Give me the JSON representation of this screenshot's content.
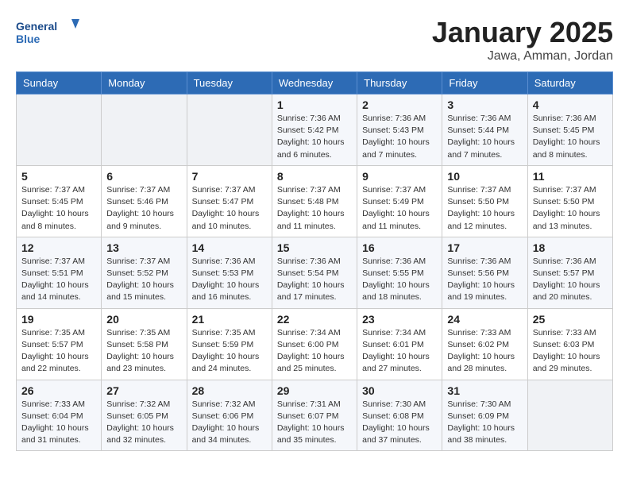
{
  "header": {
    "logo_general": "General",
    "logo_blue": "Blue",
    "month_title": "January 2025",
    "location": "Jawa, Amman, Jordan"
  },
  "weekdays": [
    "Sunday",
    "Monday",
    "Tuesday",
    "Wednesday",
    "Thursday",
    "Friday",
    "Saturday"
  ],
  "weeks": [
    [
      {
        "day": "",
        "info": ""
      },
      {
        "day": "",
        "info": ""
      },
      {
        "day": "",
        "info": ""
      },
      {
        "day": "1",
        "info": "Sunrise: 7:36 AM\nSunset: 5:42 PM\nDaylight: 10 hours\nand 6 minutes."
      },
      {
        "day": "2",
        "info": "Sunrise: 7:36 AM\nSunset: 5:43 PM\nDaylight: 10 hours\nand 7 minutes."
      },
      {
        "day": "3",
        "info": "Sunrise: 7:36 AM\nSunset: 5:44 PM\nDaylight: 10 hours\nand 7 minutes."
      },
      {
        "day": "4",
        "info": "Sunrise: 7:36 AM\nSunset: 5:45 PM\nDaylight: 10 hours\nand 8 minutes."
      }
    ],
    [
      {
        "day": "5",
        "info": "Sunrise: 7:37 AM\nSunset: 5:45 PM\nDaylight: 10 hours\nand 8 minutes."
      },
      {
        "day": "6",
        "info": "Sunrise: 7:37 AM\nSunset: 5:46 PM\nDaylight: 10 hours\nand 9 minutes."
      },
      {
        "day": "7",
        "info": "Sunrise: 7:37 AM\nSunset: 5:47 PM\nDaylight: 10 hours\nand 10 minutes."
      },
      {
        "day": "8",
        "info": "Sunrise: 7:37 AM\nSunset: 5:48 PM\nDaylight: 10 hours\nand 11 minutes."
      },
      {
        "day": "9",
        "info": "Sunrise: 7:37 AM\nSunset: 5:49 PM\nDaylight: 10 hours\nand 11 minutes."
      },
      {
        "day": "10",
        "info": "Sunrise: 7:37 AM\nSunset: 5:50 PM\nDaylight: 10 hours\nand 12 minutes."
      },
      {
        "day": "11",
        "info": "Sunrise: 7:37 AM\nSunset: 5:50 PM\nDaylight: 10 hours\nand 13 minutes."
      }
    ],
    [
      {
        "day": "12",
        "info": "Sunrise: 7:37 AM\nSunset: 5:51 PM\nDaylight: 10 hours\nand 14 minutes."
      },
      {
        "day": "13",
        "info": "Sunrise: 7:37 AM\nSunset: 5:52 PM\nDaylight: 10 hours\nand 15 minutes."
      },
      {
        "day": "14",
        "info": "Sunrise: 7:36 AM\nSunset: 5:53 PM\nDaylight: 10 hours\nand 16 minutes."
      },
      {
        "day": "15",
        "info": "Sunrise: 7:36 AM\nSunset: 5:54 PM\nDaylight: 10 hours\nand 17 minutes."
      },
      {
        "day": "16",
        "info": "Sunrise: 7:36 AM\nSunset: 5:55 PM\nDaylight: 10 hours\nand 18 minutes."
      },
      {
        "day": "17",
        "info": "Sunrise: 7:36 AM\nSunset: 5:56 PM\nDaylight: 10 hours\nand 19 minutes."
      },
      {
        "day": "18",
        "info": "Sunrise: 7:36 AM\nSunset: 5:57 PM\nDaylight: 10 hours\nand 20 minutes."
      }
    ],
    [
      {
        "day": "19",
        "info": "Sunrise: 7:35 AM\nSunset: 5:57 PM\nDaylight: 10 hours\nand 22 minutes."
      },
      {
        "day": "20",
        "info": "Sunrise: 7:35 AM\nSunset: 5:58 PM\nDaylight: 10 hours\nand 23 minutes."
      },
      {
        "day": "21",
        "info": "Sunrise: 7:35 AM\nSunset: 5:59 PM\nDaylight: 10 hours\nand 24 minutes."
      },
      {
        "day": "22",
        "info": "Sunrise: 7:34 AM\nSunset: 6:00 PM\nDaylight: 10 hours\nand 25 minutes."
      },
      {
        "day": "23",
        "info": "Sunrise: 7:34 AM\nSunset: 6:01 PM\nDaylight: 10 hours\nand 27 minutes."
      },
      {
        "day": "24",
        "info": "Sunrise: 7:33 AM\nSunset: 6:02 PM\nDaylight: 10 hours\nand 28 minutes."
      },
      {
        "day": "25",
        "info": "Sunrise: 7:33 AM\nSunset: 6:03 PM\nDaylight: 10 hours\nand 29 minutes."
      }
    ],
    [
      {
        "day": "26",
        "info": "Sunrise: 7:33 AM\nSunset: 6:04 PM\nDaylight: 10 hours\nand 31 minutes."
      },
      {
        "day": "27",
        "info": "Sunrise: 7:32 AM\nSunset: 6:05 PM\nDaylight: 10 hours\nand 32 minutes."
      },
      {
        "day": "28",
        "info": "Sunrise: 7:32 AM\nSunset: 6:06 PM\nDaylight: 10 hours\nand 34 minutes."
      },
      {
        "day": "29",
        "info": "Sunrise: 7:31 AM\nSunset: 6:07 PM\nDaylight: 10 hours\nand 35 minutes."
      },
      {
        "day": "30",
        "info": "Sunrise: 7:30 AM\nSunset: 6:08 PM\nDaylight: 10 hours\nand 37 minutes."
      },
      {
        "day": "31",
        "info": "Sunrise: 7:30 AM\nSunset: 6:09 PM\nDaylight: 10 hours\nand 38 minutes."
      },
      {
        "day": "",
        "info": ""
      }
    ]
  ]
}
